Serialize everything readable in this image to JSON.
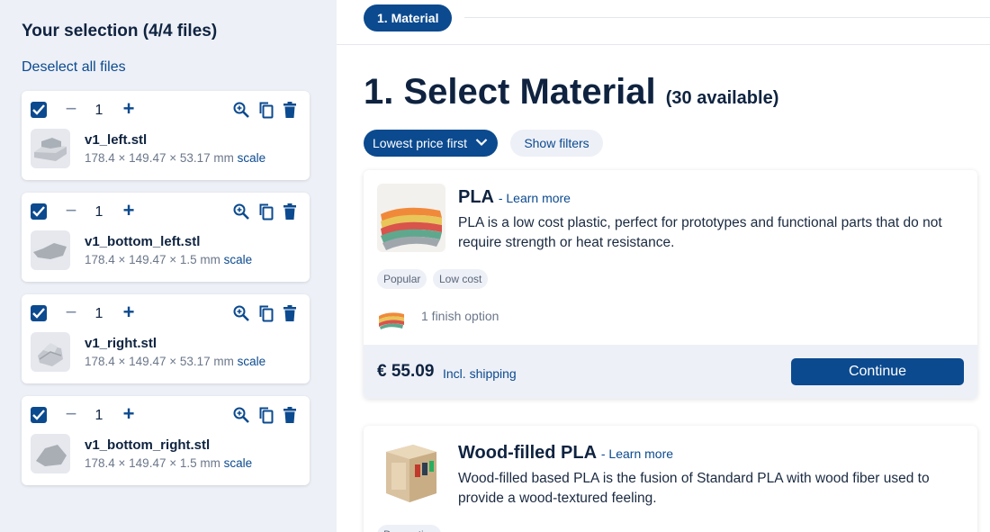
{
  "sidebar": {
    "title": "Your selection (4/4 files)",
    "deselect_label": "Deselect all files",
    "files": [
      {
        "name": "v1_left.stl",
        "dims": "178.4 × 149.47 × 53.17 mm",
        "qty": "1",
        "scale_label": "scale",
        "minus": "−",
        "plus": "+"
      },
      {
        "name": "v1_bottom_left.stl",
        "dims": "178.4 × 149.47 × 1.5 mm",
        "qty": "1",
        "scale_label": "scale",
        "minus": "−",
        "plus": "+"
      },
      {
        "name": "v1_right.stl",
        "dims": "178.4 × 149.47 × 53.17 mm",
        "qty": "1",
        "scale_label": "scale",
        "minus": "−",
        "plus": "+"
      },
      {
        "name": "v1_bottom_right.stl",
        "dims": "178.4 × 149.47 × 1.5 mm",
        "qty": "1",
        "scale_label": "scale",
        "minus": "−",
        "plus": "+"
      }
    ]
  },
  "main": {
    "step_label": "1. Material",
    "title": "1. Select Material",
    "available": "(30 available)",
    "sort_label": "Lowest price first",
    "filters_label": "Show filters",
    "materials": [
      {
        "name": "PLA",
        "learn_more": "- Learn more",
        "description": "PLA is a low cost plastic, perfect for prototypes and functional parts that do not require strength or heat resistance.",
        "tags": [
          "Popular",
          "Low cost"
        ],
        "finish": "1 finish option",
        "price": "€ 55.09",
        "price_note": "Incl. shipping",
        "continue_label": "Continue"
      },
      {
        "name": "Wood-filled PLA",
        "learn_more": "- Learn more",
        "description": "Wood-filled based PLA is the fusion of Standard PLA with wood fiber used to provide a wood-textured feeling.",
        "tags": [
          "Decorative"
        ]
      }
    ]
  },
  "colors": {
    "accent": "#0b4a8f",
    "sidebar_bg": "#eef0f7",
    "text": "#0f2340"
  }
}
